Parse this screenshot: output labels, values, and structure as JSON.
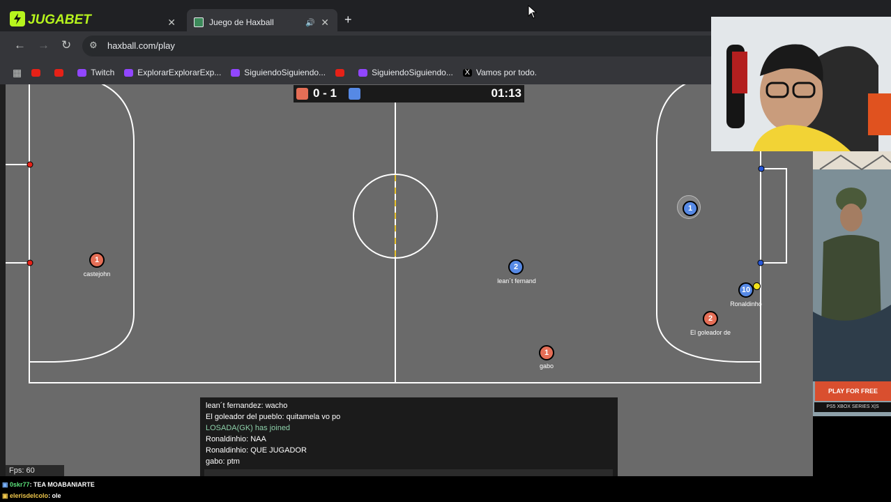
{
  "browser": {
    "tabs": [
      {
        "label": "JUGABET",
        "active": false
      },
      {
        "label": "Juego de Haxball",
        "active": true
      }
    ],
    "url": "haxball.com/play",
    "bookmarks": [
      {
        "label": "",
        "icon": "youtube-icon"
      },
      {
        "label": "",
        "icon": "youtube-icon"
      },
      {
        "label": "Twitch",
        "icon": "twitch-icon"
      },
      {
        "label": "ExplorarExplorarExp...",
        "icon": "twitch-icon"
      },
      {
        "label": "SiguiendoSiguiendo...",
        "icon": "twitch-icon"
      },
      {
        "label": "",
        "icon": "youtube-icon"
      },
      {
        "label": "SiguiendoSiguiendo...",
        "icon": "twitch-icon"
      },
      {
        "label": "Vamos por todo.",
        "icon": "x-icon"
      }
    ]
  },
  "game": {
    "score": "0 - 1",
    "time": "01:13",
    "fps": "Fps: 60",
    "colors": {
      "red": "#e56e56",
      "blue": "#5689e5",
      "field": "#6a6a6a"
    },
    "players": [
      {
        "team": "red",
        "number": "1",
        "name": "castejohn"
      },
      {
        "team": "blue",
        "number": "2",
        "name": "lean´t fernand"
      },
      {
        "team": "blue",
        "number": "1",
        "name": ""
      },
      {
        "team": "blue",
        "number": "10",
        "name": "Ronaldinho"
      },
      {
        "team": "red",
        "number": "2",
        "name": "El goleador de"
      },
      {
        "team": "red",
        "number": "1",
        "name": "gabo"
      }
    ],
    "chat": [
      {
        "text": "lean´t fernandez: wacho",
        "type": "message"
      },
      {
        "text": "El goleador del pueblo: quitamela vo po",
        "type": "message"
      },
      {
        "text": "LOSADA(GK) has joined",
        "type": "system"
      },
      {
        "text": "Ronaldinhio: NAA",
        "type": "message"
      },
      {
        "text": "Ronaldinhio: QUE JUGADOR",
        "type": "message"
      },
      {
        "text": "gabo: ptm",
        "type": "message"
      }
    ]
  },
  "ad": {
    "cta": "PLAY FOR FREE",
    "platforms": "PS5  XBOX SERIES X|S"
  },
  "stream_chat": [
    {
      "user": "0skr77",
      "text": ": TEA MOABANIARTE"
    },
    {
      "user": "elerisdelcolo",
      "text": ": ole"
    }
  ]
}
